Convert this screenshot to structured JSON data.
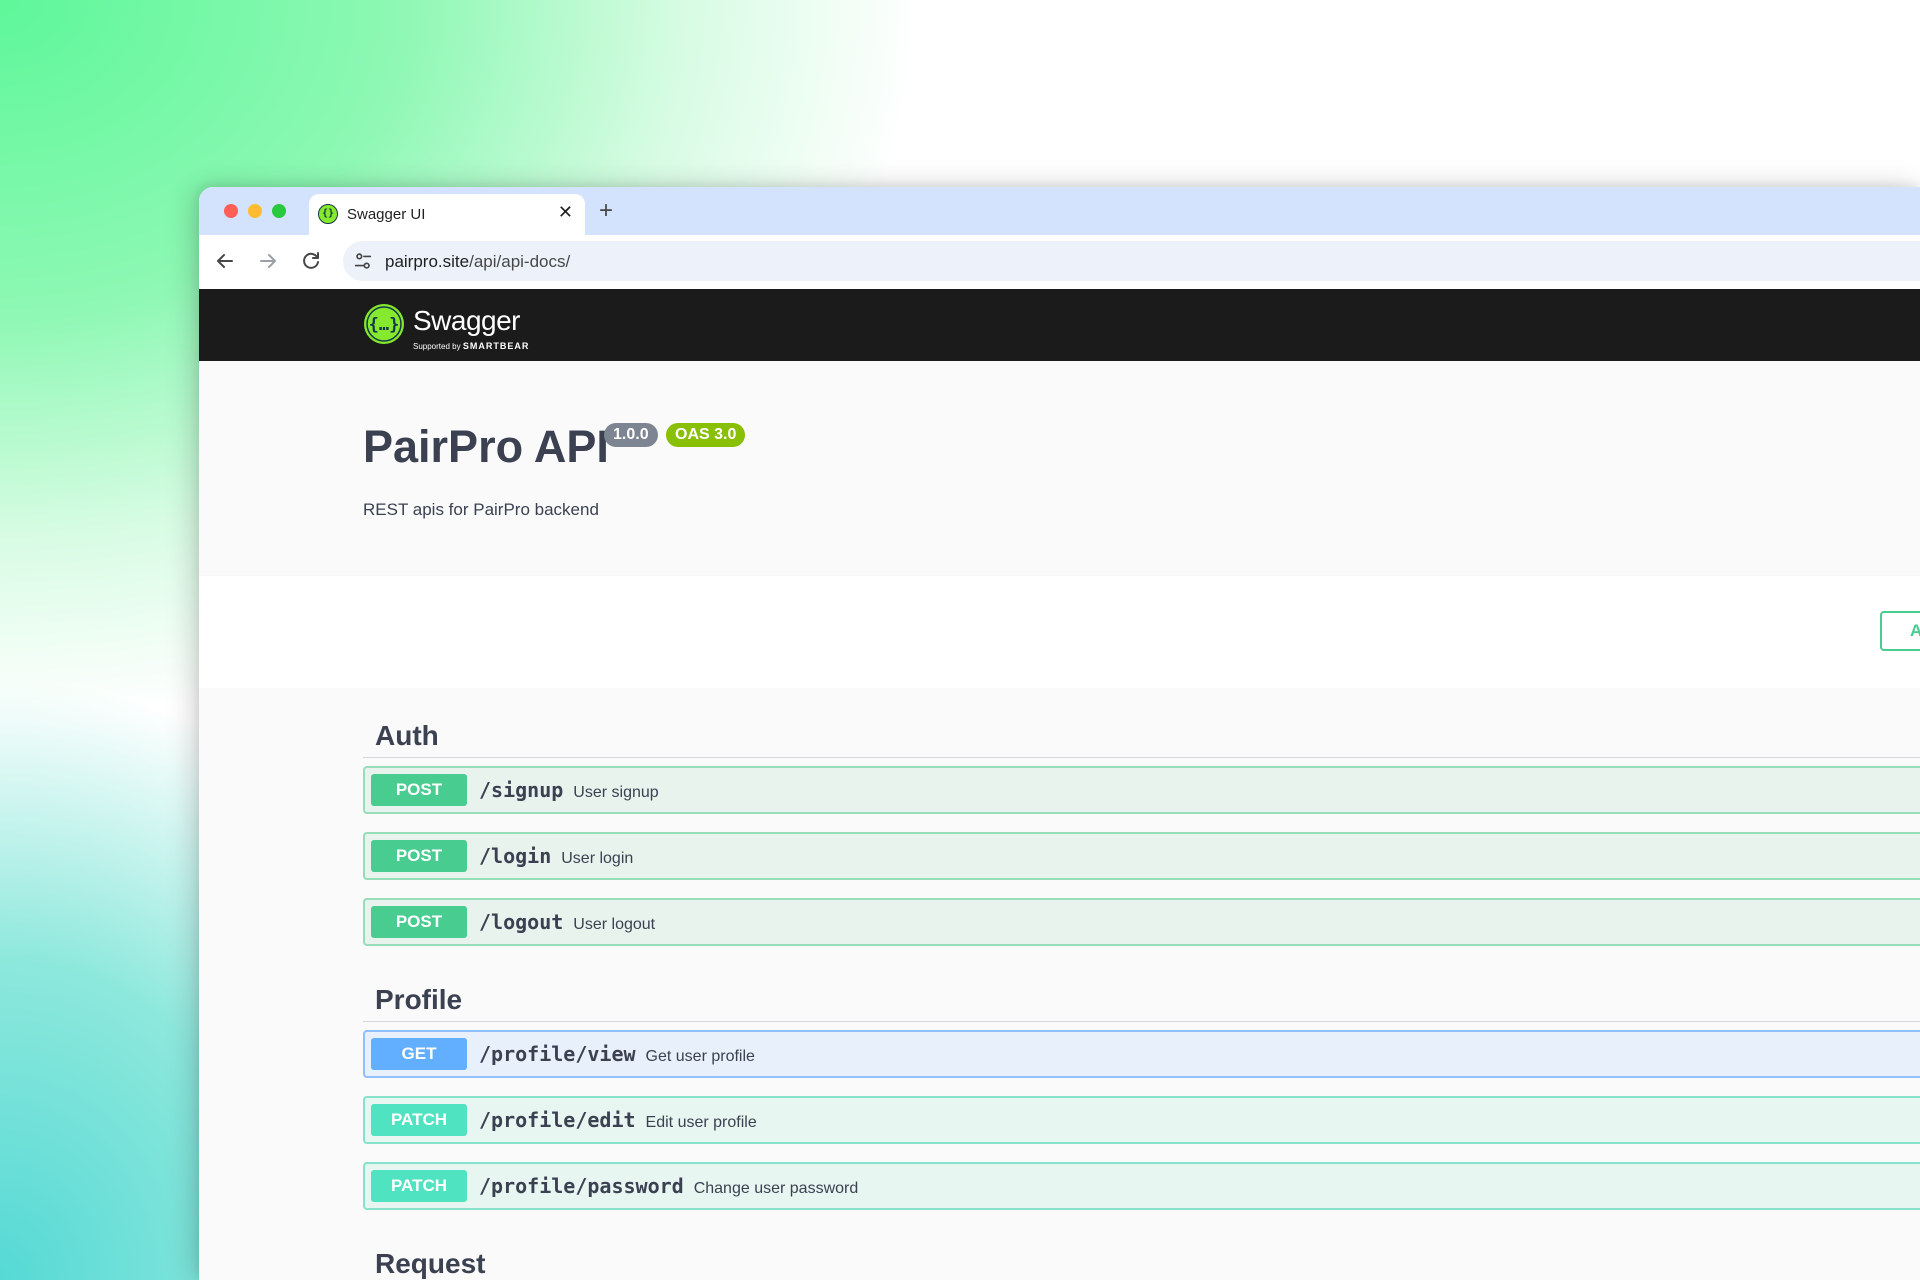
{
  "browser": {
    "tab_title": "Swagger UI",
    "url_host": "pairpro.site",
    "url_path": "/api/api-docs/"
  },
  "swagger": {
    "brand": "Swagger",
    "supported_by": "Supported by",
    "company": "SMARTBEAR"
  },
  "info": {
    "title": "PairPro API",
    "version": "1.0.0",
    "oas": "OAS 3.0",
    "description": "REST apis for PairPro backend"
  },
  "scheme": {
    "authorize_label": "A"
  },
  "tags": [
    {
      "name": "Auth",
      "operations": [
        {
          "method": "POST",
          "path": "/signup",
          "summary": "User signup"
        },
        {
          "method": "POST",
          "path": "/login",
          "summary": "User login"
        },
        {
          "method": "POST",
          "path": "/logout",
          "summary": "User logout"
        }
      ]
    },
    {
      "name": "Profile",
      "operations": [
        {
          "method": "GET",
          "path": "/profile/view",
          "summary": "Get user profile"
        },
        {
          "method": "PATCH",
          "path": "/profile/edit",
          "summary": "Edit user profile"
        },
        {
          "method": "PATCH",
          "path": "/profile/password",
          "summary": "Change user password"
        }
      ]
    },
    {
      "name": "Request",
      "operations": []
    }
  ],
  "colors": {
    "post": "#49cc90",
    "get": "#61affe",
    "patch": "#50e3c2",
    "swagger_green": "#85ea2d",
    "topbar": "#1b1b1b"
  }
}
